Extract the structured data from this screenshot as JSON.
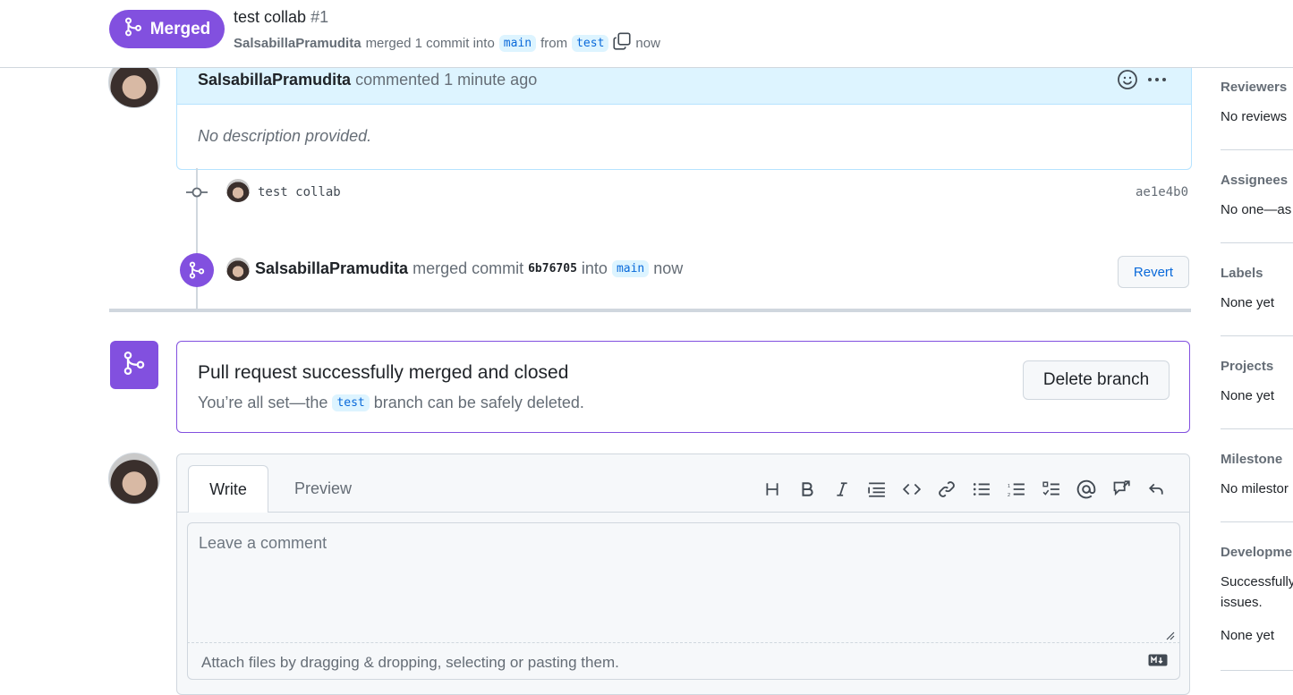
{
  "header": {
    "status_label": "Merged",
    "title": "test collab",
    "number": "#1",
    "author": "SalsabillaPramudita",
    "merged_text": "merged 1 commit into",
    "base_branch": "main",
    "from_text": "from",
    "head_branch": "test",
    "time": "now"
  },
  "comment": {
    "author": "SalsabillaPramudita",
    "action": "commented 1 minute ago",
    "body": "No description provided."
  },
  "commit": {
    "message": "test collab",
    "sha": "ae1e4b0"
  },
  "merge_event": {
    "author": "SalsabillaPramudita",
    "text": "merged commit",
    "sha": "6b76705",
    "into": "into",
    "branch": "main",
    "time": "now",
    "revert_label": "Revert"
  },
  "merge_box": {
    "title": "Pull request successfully merged and closed",
    "sub_prefix": "You’re all set—the",
    "branch": "test",
    "sub_suffix": "branch can be safely deleted.",
    "delete_label": "Delete branch"
  },
  "editor": {
    "tab_write": "Write",
    "tab_preview": "Preview",
    "placeholder": "Leave a comment",
    "attach_text": "Attach files by dragging & dropping, selecting or pasting them."
  },
  "sidebar": {
    "reviewers": {
      "title": "Reviewers",
      "value": "No reviews"
    },
    "assignees": {
      "title": "Assignees",
      "value": "No one—as"
    },
    "labels": {
      "title": "Labels",
      "value": "None yet"
    },
    "projects": {
      "title": "Projects",
      "value": "None yet"
    },
    "milestone": {
      "title": "Milestone",
      "value": "No milestor"
    },
    "development": {
      "title": "Developme",
      "value_line1": "Successfully",
      "value_line2": "issues.",
      "value_line3": "None yet"
    }
  },
  "colors": {
    "merged_purple": "#8250df",
    "link_blue": "#0969da",
    "comment_header_bg": "#ddf4ff"
  }
}
